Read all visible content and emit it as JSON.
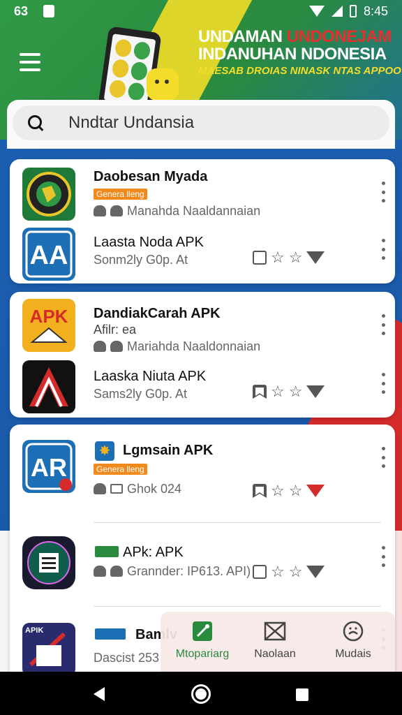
{
  "status_bar": {
    "time": "63",
    "clock": "8:45"
  },
  "header": {
    "line1_a": "UNDAMAN ",
    "line1_b": "UNDONEJAM",
    "line2": "INDANUHAN NDONESIA",
    "line3": "MAESAB DROIAS NINASK NTAS APPOO"
  },
  "search": {
    "value": "Nndtar Undansia"
  },
  "cards": [
    {
      "items": [
        {
          "title": "Daobesan Myada",
          "badge": "Genera lleng",
          "sub": "Manahda Naaldannaian"
        },
        {
          "title": "Laasta Noda APK",
          "sub": "Sonm2ly G0p. At"
        }
      ]
    },
    {
      "items": [
        {
          "title": "DandiakCarah APK",
          "subtitle": "Afilr: ea",
          "sub": "Mariahda Naaldonnaian"
        },
        {
          "title": "Laaska Niuta APK",
          "sub": "Sams2ly G0p. At"
        }
      ]
    },
    {
      "items": [
        {
          "title": "Lgmsain APK",
          "badge": "Genera lleng",
          "sub": "Ghok 024"
        },
        {
          "title": "APk: APK",
          "sub": "Grannder: IP613. API)"
        },
        {
          "title": "Bamlv",
          "sub": "Dascist 253"
        }
      ]
    }
  ],
  "bottom_nav": [
    {
      "label": "Mtopariarg",
      "icon": "brush-icon",
      "active": true
    },
    {
      "label": "Naolaan",
      "icon": "mail-icon",
      "active": false
    },
    {
      "label": "Mudais",
      "icon": "face-icon",
      "active": false
    }
  ],
  "icons": {
    "app1": "globe-seal-icon",
    "app2": "AA",
    "app3": "APK",
    "app4": "arrow-a-icon",
    "app5": "AR",
    "app6": "circle-logo-icon",
    "app7": "APK",
    "app7_pre": "APIK"
  },
  "colors": {
    "accent": "#2a8a3e",
    "badge": "#f08a1c",
    "red": "#d62b2b",
    "blue": "#1c58a8"
  }
}
